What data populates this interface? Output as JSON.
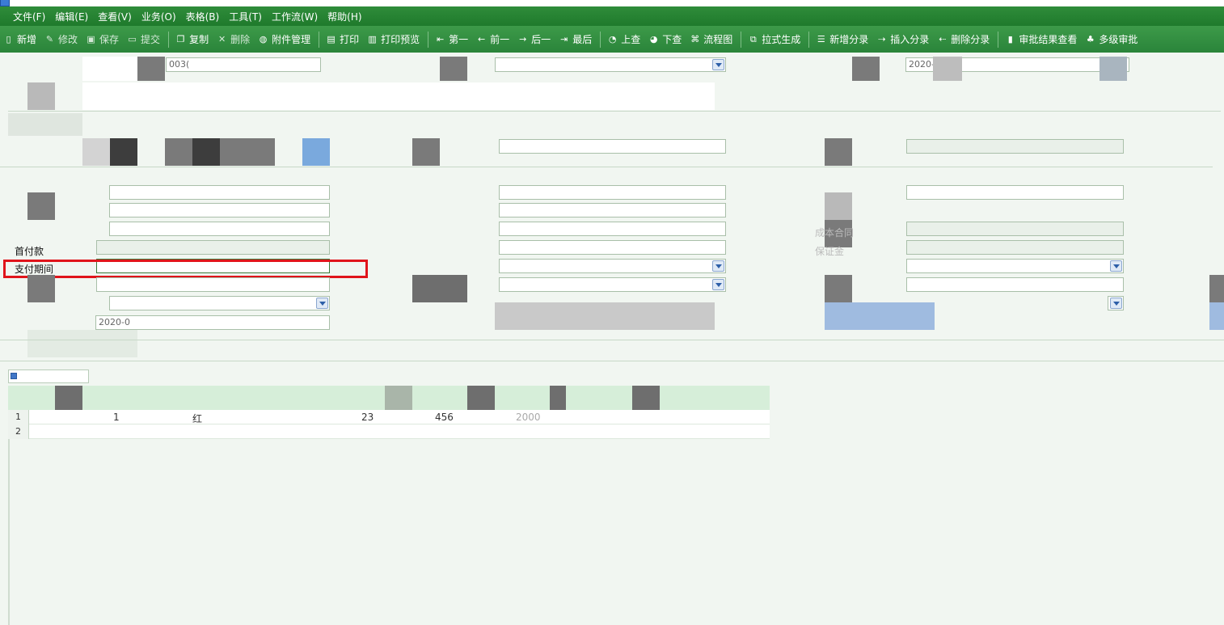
{
  "menu": [
    "文件(F)",
    "编辑(E)",
    "查看(V)",
    "业务(O)",
    "表格(B)",
    "工具(T)",
    "工作流(W)",
    "帮助(H)"
  ],
  "toolbar": [
    {
      "label": "新增",
      "icon": "new-doc-icon",
      "dim": false
    },
    {
      "label": "修改",
      "icon": "edit-pencil-icon",
      "dim": true
    },
    {
      "label": "保存",
      "icon": "save-disk-icon",
      "dim": true
    },
    {
      "label": "提交",
      "icon": "submit-icon",
      "dim": true
    },
    {
      "label": "复制",
      "icon": "copy-icon",
      "dim": false
    },
    {
      "label": "删除",
      "icon": "delete-x-icon",
      "dim": true
    },
    {
      "label": "附件管理",
      "icon": "attachment-icon",
      "dim": false
    },
    {
      "label": "打印",
      "icon": "print-icon",
      "dim": false
    },
    {
      "label": "打印预览",
      "icon": "print-preview-icon",
      "dim": false
    },
    {
      "label": "第一",
      "icon": "first-arrow-icon",
      "dim": false
    },
    {
      "label": "前一",
      "icon": "prev-arrow-icon",
      "dim": false
    },
    {
      "label": "后一",
      "icon": "next-arrow-icon",
      "dim": false
    },
    {
      "label": "最后",
      "icon": "last-arrow-icon",
      "dim": false
    },
    {
      "label": "上查",
      "icon": "search-up-icon",
      "dim": false
    },
    {
      "label": "下查",
      "icon": "search-down-icon",
      "dim": false
    },
    {
      "label": "流程图",
      "icon": "flowchart-icon",
      "dim": false
    },
    {
      "label": "拉式生成",
      "icon": "pull-generate-icon",
      "dim": false
    },
    {
      "label": "新增分录",
      "icon": "add-entry-icon",
      "dim": false
    },
    {
      "label": "插入分录",
      "icon": "insert-entry-icon",
      "dim": false
    },
    {
      "label": "删除分录",
      "icon": "delete-entry-icon",
      "dim": false
    },
    {
      "label": "审批结果查看",
      "icon": "approval-result-icon",
      "dim": false
    },
    {
      "label": "多级审批",
      "icon": "multi-approval-icon",
      "dim": false
    }
  ],
  "header": {
    "number_value": "003(",
    "date_value": "2020-05-20"
  },
  "form": {
    "prepay_label": "首付款",
    "payment_period_label": "支付期间",
    "payment_period_value": "",
    "bottom_date_value": "2020-0",
    "right_label_1": "成本合同",
    "right_label_2": "保证金"
  },
  "grid": {
    "rows": [
      {
        "num": "1",
        "c1": "1",
        "c2": "红",
        "c3": "23",
        "c4": "456",
        "c5": "2000"
      },
      {
        "num": "2",
        "c1": "",
        "c2": "",
        "c3": "",
        "c4": "",
        "c5": ""
      }
    ]
  },
  "colors": {
    "toolbar_green": "#2f8c3a",
    "highlight_red": "#e0141b"
  }
}
